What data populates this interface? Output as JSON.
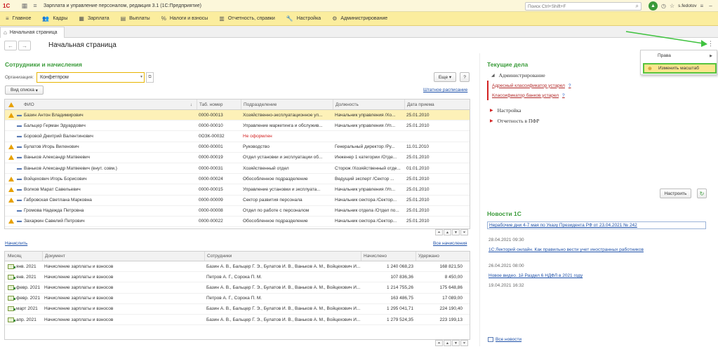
{
  "titlebar": {
    "logo": "1С",
    "app_title": "Зарплата и управление персоналом, редакция 3.1  (1С:Предприятие)",
    "search_placeholder": "Поиск Ctrl+Shift+F",
    "user": "s.fedotov"
  },
  "menu": [
    {
      "icon": "hamburger-icon",
      "label": "Главное"
    },
    {
      "icon": "people-icon",
      "label": "Кадры"
    },
    {
      "icon": "calculator-icon",
      "label": "Зарплата"
    },
    {
      "icon": "wallet-icon",
      "label": "Выплаты"
    },
    {
      "icon": "percent-icon",
      "label": "Налоги и взносы"
    },
    {
      "icon": "chart-icon",
      "label": "Отчетность, справки"
    },
    {
      "icon": "wrench-icon",
      "label": "Настройка"
    },
    {
      "icon": "gear-icon",
      "label": "Администрирование"
    }
  ],
  "tabs": {
    "home": "Начальная страница"
  },
  "page": {
    "title": "Начальная страница"
  },
  "employees": {
    "title": "Сотрудники и начисления",
    "org_label": "Организация:",
    "org_value": "Конфетпром",
    "more_button": "Еще",
    "help_button": "?",
    "view_button": "Вид списка",
    "staffing_link": "Штатное расписание",
    "columns": {
      "fio": "ФИО",
      "tab": "Таб. номер",
      "dep": "Подразделение",
      "pos": "Должность",
      "date": "Дата приема"
    },
    "rows": [
      {
        "warn": true,
        "fio": "Базин Антон Владимирович",
        "tab": "0000-00013",
        "dep": "Хозяйственно-эксплуатационное уп...",
        "pos": "Начальник управления /Хо...",
        "date": "25.01.2010",
        "selected": true
      },
      {
        "warn": false,
        "fio": "Бальцер Герман Эдуардович",
        "tab": "0000-00010",
        "dep": "Управление маркетинга и обслужив...",
        "pos": "Начальник управления /Уп...",
        "date": "25.01.2010"
      },
      {
        "warn": false,
        "fio": "Боровой Дмитрий Валентинович",
        "tab": "0ОЗК-00032",
        "dep": "Не оформлен",
        "pos": "",
        "date": "",
        "red": true
      },
      {
        "warn": true,
        "fio": "Булатов Игорь Виленович",
        "tab": "0000-00001",
        "dep": "Руководство",
        "pos": "Генеральный директор /Ру...",
        "date": "11.01.2010"
      },
      {
        "warn": true,
        "fio": "Ваньков Александр Матвеевич",
        "tab": "0000-00019",
        "dep": "Отдел установки и эксплуатации об...",
        "pos": "Инженер 1 категории /Отде...",
        "date": "25.01.2010"
      },
      {
        "warn": false,
        "fio": "Ваньков Александр Матвеевич (внут. совм.)",
        "tab": "0000-00031",
        "dep": "Хозяйственный отдел",
        "pos": "Сторож /Хозяйственный отде...",
        "date": "01.01.2010"
      },
      {
        "warn": true,
        "fio": "Войцехович Игорь Борисович",
        "tab": "0000-00024",
        "dep": "Обособленное подразделение",
        "pos": "Ведущий эксперт /Сектор ...",
        "date": "25.01.2010"
      },
      {
        "warn": true,
        "fio": "Волков Марат Савельевич",
        "tab": "0000-00015",
        "dep": "Управление установки и эксплуата...",
        "pos": "Начальник управления /Уп...",
        "date": "25.01.2010"
      },
      {
        "warn": true,
        "fio": "Габровская Светлана Марковна",
        "tab": "0000-00009",
        "dep": "Сектор развития персонала",
        "pos": "Начальник сектора /Сектор...",
        "date": "25.01.2010"
      },
      {
        "warn": false,
        "fio": "Громова Надежда Петровна",
        "tab": "0000-00008",
        "dep": "Отдел по работе с персоналом",
        "pos": "Начальник отдела /Отдел по...",
        "date": "25.01.2010"
      },
      {
        "warn": true,
        "fio": "Захаркин Савелий Петрович",
        "tab": "0000-00022",
        "dep": "Обособленное подразделение",
        "pos": "Начальник сектора /Сектор...",
        "date": "25.01.2010"
      }
    ]
  },
  "accruals": {
    "accrue_link": "Начислить",
    "all_link": "Все начисления",
    "columns": {
      "month": "Месяц",
      "doc": "Документ",
      "emp": "Сотрудники",
      "acc": "Начислено",
      "ret": "Удержано"
    },
    "rows": [
      {
        "month": "янв. 2021",
        "doc": "Начисление зарплаты и взносов",
        "emp": "Базин А. В., Бальцер Г. Э., Булатов И. В., Ваньков А. М., Войцехович И....",
        "acc": "1 240 068,23",
        "ret": "168 821,50"
      },
      {
        "month": "янв. 2021",
        "doc": "Начисление зарплаты и взносов",
        "emp": "Петров А. Г., Сорока П. М.",
        "acc": "107 836,36",
        "ret": "8 450,00"
      },
      {
        "month": "февр. 2021",
        "doc": "Начисление зарплаты и взносов",
        "emp": "Базин А. В., Бальцер Г. Э., Булатов И. В., Ваньков А. М., Войцехович И....",
        "acc": "1 214 755,26",
        "ret": "175 648,86"
      },
      {
        "month": "февр. 2021",
        "doc": "Начисление зарплаты и взносов",
        "emp": "Петров А. Г., Сорока П. М.",
        "acc": "163 486,75",
        "ret": "17 089,00"
      },
      {
        "month": "март 2021",
        "doc": "Начисление зарплаты и взносов",
        "emp": "Базин А. В., Бальцер Г. Э., Булатов И. В., Ваньков А. М., Войцехович И....",
        "acc": "1 295 041,71",
        "ret": "224 190,40"
      },
      {
        "month": "апр. 2021",
        "doc": "Начисление зарплаты и взносов",
        "emp": "Базин А. В., Бальцер Г. Э., Булатов И. В., Ваньков А. М., Войцехович И....",
        "acc": "1 279 524,35",
        "ret": "223 199,13"
      }
    ]
  },
  "current": {
    "title": "Текущие дела",
    "group_admin": "Администрирование",
    "links": [
      "Адресный классификатор устарел",
      "Классификатор банков устарел"
    ],
    "group_settings": "Настройка",
    "group_pfr": "Отчетность в ПФР",
    "configure_button": "Настроить"
  },
  "news": {
    "title": "Новости 1С",
    "items": [
      {
        "text": "Нерабочие дни 4-7 мая по Указу Президента РФ от 23.04.2021 № 242",
        "date": "28.04.2021 09:30"
      },
      {
        "text": "1С:Лекторий онлайн. Как правильно вести учет иностранных работников",
        "date": "26.04.2021 08:00"
      },
      {
        "text": "Новое видео. 1й Раздел 6 НДФЛ в 2021 году",
        "date": "19.04.2021 16:32"
      }
    ],
    "all_link": "Все новости"
  },
  "popup": {
    "rights": "Права",
    "zoom": "Изменить масштаб"
  }
}
